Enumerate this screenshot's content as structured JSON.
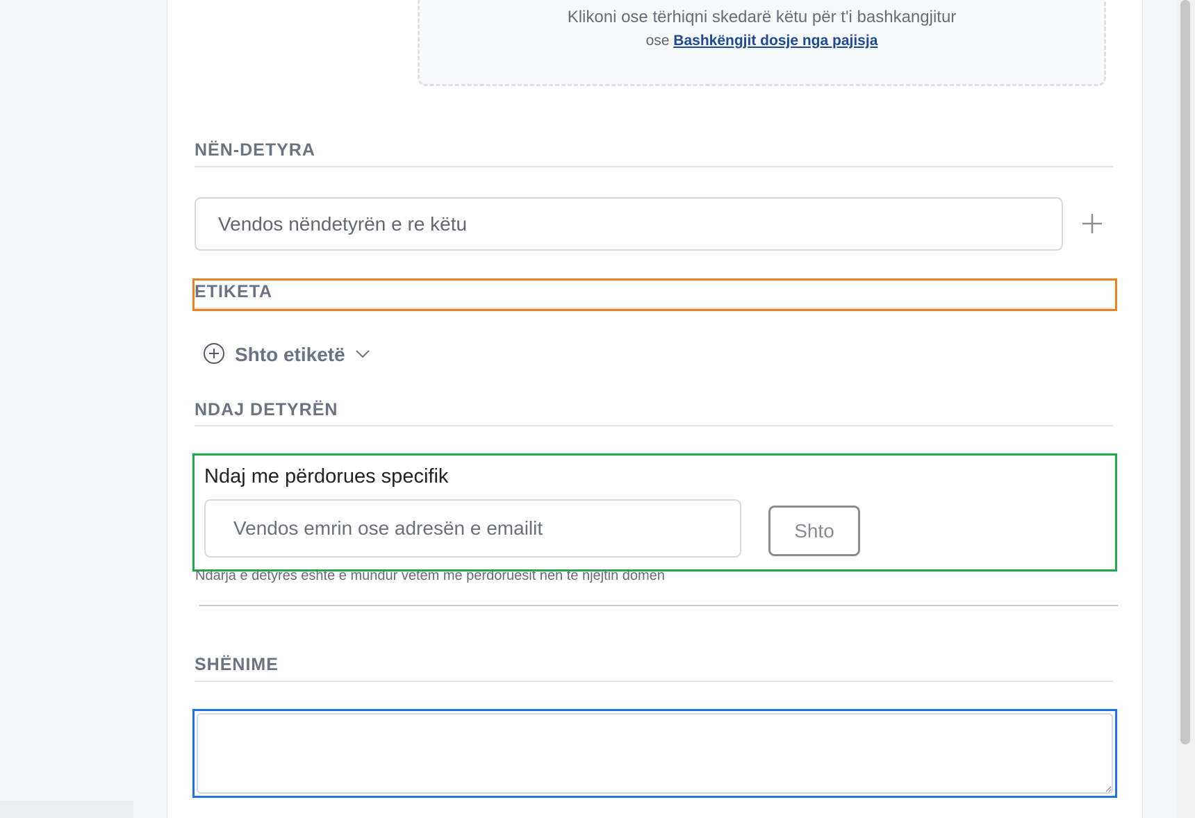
{
  "attachments": {
    "dropzone_text": "Klikoni ose tërhiqni skedarë këtu për t'i bashkangjitur",
    "or_text": "ose",
    "upload_link": "Bashkëngjit dosje nga pajisja"
  },
  "subtasks": {
    "title": "NËN-DETYRA",
    "input_placeholder": "Vendos nëndetyrën e re këtu",
    "add_icon": "plus-icon"
  },
  "labels": {
    "title": "ETIKETA",
    "add_label": "Shto etiketë",
    "add_icon": "plus-circle-icon",
    "dropdown_icon": "chevron-down-icon"
  },
  "share": {
    "title": "NDAJ DETYRËN",
    "subtitle": "Ndaj me përdorues specifik",
    "input_placeholder": "Vendos emrin ose adresën e emailit",
    "button_label": "Shto",
    "hint": "Ndarja e detyrës është e mundur vetëm me përdoruesit nën të njëjtin domen"
  },
  "notes": {
    "title": "SHËNIME",
    "value": ""
  },
  "colors": {
    "highlight_orange": "#f07f1f",
    "highlight_green": "#1faa49",
    "highlight_blue": "#1f73ea",
    "link": "#1d4a97",
    "section_title": "#697383"
  }
}
